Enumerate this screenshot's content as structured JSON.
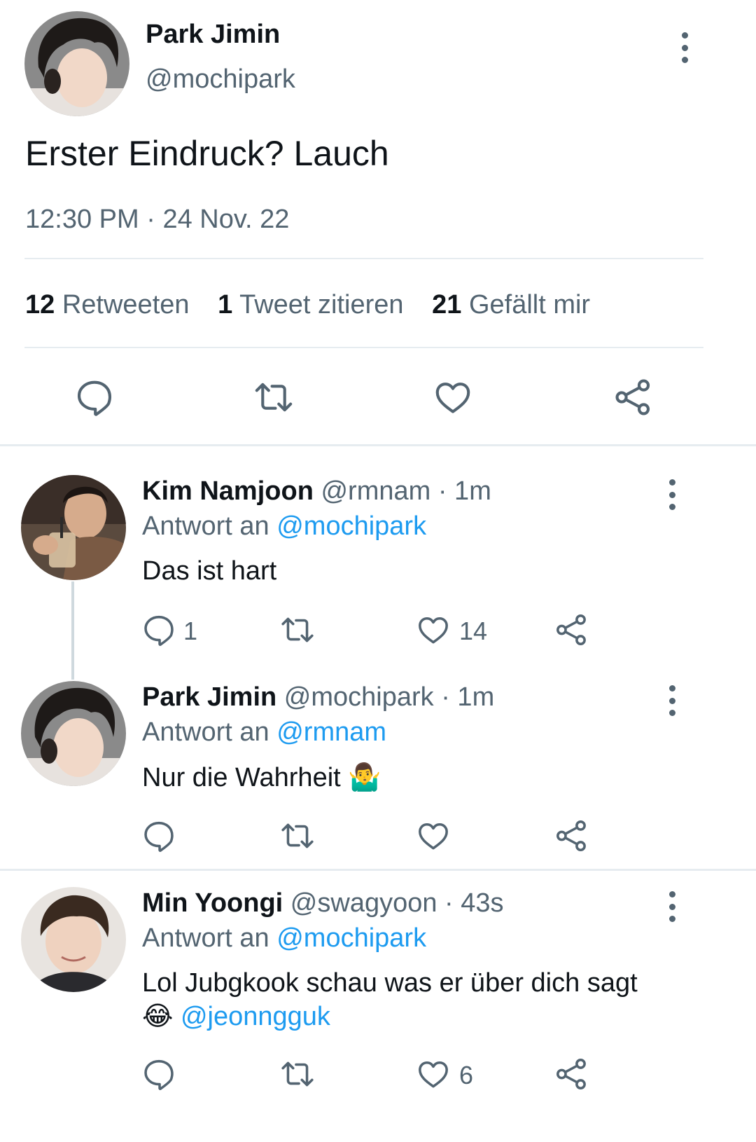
{
  "main_tweet": {
    "author_name": "Park Jimin",
    "handle": "@mochipark",
    "text": "Erster Eindruck? Lauch",
    "time": "12:30 PM",
    "separator": "·",
    "date": "24 Nov. 22",
    "stats": {
      "retweets_count": "12",
      "retweets_label": "Retweeten",
      "quotes_count": "1",
      "quotes_label": "Tweet zitieren",
      "likes_count": "21",
      "likes_label": "Gefällt mir"
    }
  },
  "replies": [
    {
      "author_name": "Kim Namjoon",
      "handle": "@rmnam",
      "meta": "· 1m",
      "reply_prefix": "Antwort an",
      "reply_to": "@mochipark",
      "text": "Das ist hart",
      "reply_count": "1",
      "like_count": "14"
    },
    {
      "author_name": "Park Jimin",
      "handle": "@mochipark",
      "meta": "· 1m",
      "reply_prefix": "Antwort an",
      "reply_to": "@rmnam",
      "text": "Nur die Wahrheit",
      "emoji": "🤷‍♂️"
    },
    {
      "author_name": "Min Yoongi",
      "handle": "@swagyoon",
      "meta": "· 43s",
      "reply_prefix": "Antwort an",
      "reply_to": "@mochipark",
      "text": "Lol Jubgkook schau was er über dich sagt",
      "emoji": "😂",
      "mention": "@jeonngguk",
      "like_count": "6"
    }
  ],
  "colors": {
    "text": "#0f1419",
    "secondary": "#536471",
    "link": "#1d9bf0",
    "divider": "#e6ecf0"
  },
  "icons": [
    "reply-icon",
    "retweet-icon",
    "like-icon",
    "share-icon",
    "more-options-icon"
  ]
}
